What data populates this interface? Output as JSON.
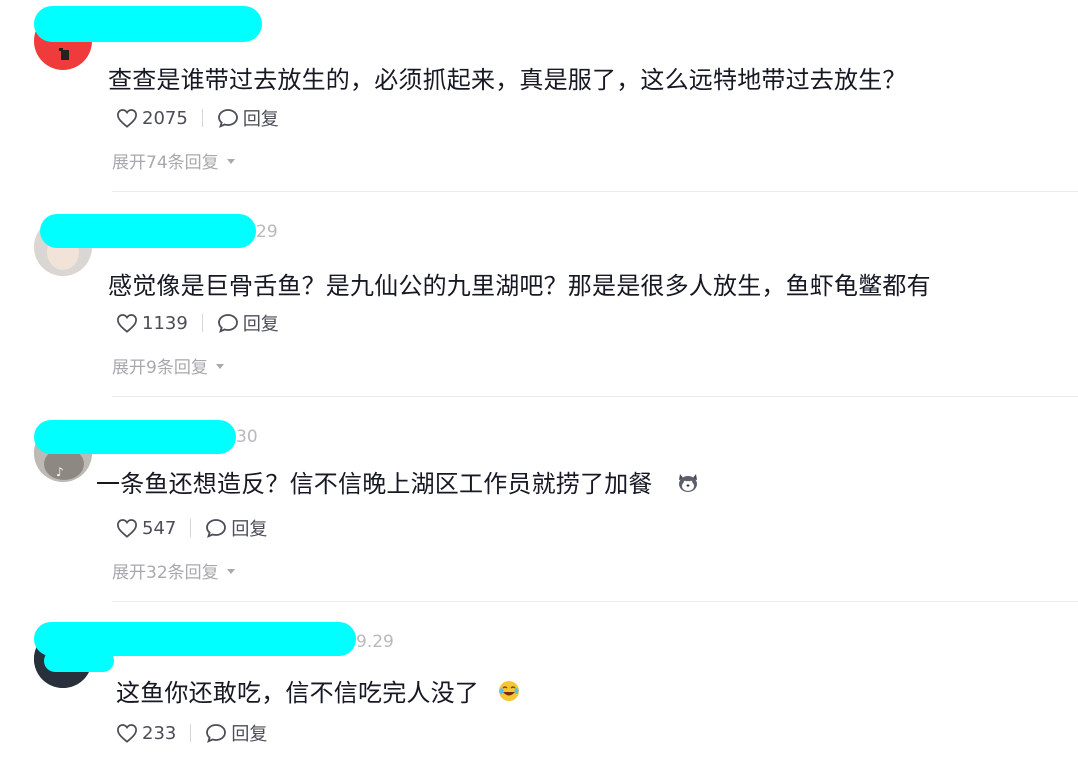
{
  "colors": {
    "redaction": "#00ffff",
    "text": "#161823",
    "meta": "#a8a9ae"
  },
  "comments": [
    {
      "timestamp": "",
      "text": "查查是谁带过去放生的，必须抓起来，真是服了，这么远特地带过去放生？",
      "likes": "2075",
      "reply_label": "回复",
      "expand_label": "展开74条回复",
      "avatar_icon": "user-avatar-red"
    },
    {
      "timestamp": "29",
      "text": "感觉像是巨骨舌鱼？是九仙公的九里湖吧？那是是很多人放生，鱼虾龟鳖都有",
      "likes": "1139",
      "reply_label": "回复",
      "expand_label": "展开9条回复",
      "avatar_icon": "user-avatar-face"
    },
    {
      "timestamp": "30",
      "text": "一条鱼还想造反？信不信晚上湖区工作员就捞了加餐",
      "likes": "547",
      "reply_label": "回复",
      "expand_label": "展开32条回复",
      "avatar_icon": "user-avatar-photo",
      "emoji_icon": "husky-emoji"
    },
    {
      "timestamp": "9.29",
      "text": "这鱼你还敢吃，信不信吃完人没了",
      "likes": "233",
      "reply_label": "回复",
      "avatar_icon": "user-avatar-dark",
      "emoji_icon": "laughing-emoji"
    }
  ]
}
